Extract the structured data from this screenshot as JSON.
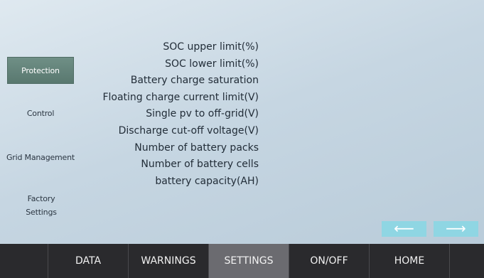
{
  "sidebar": {
    "items": [
      {
        "label": "Protection",
        "active": true
      },
      {
        "label": "Control",
        "active": false
      },
      {
        "label": "Grid Management",
        "active": false
      },
      {
        "label": "Factory Settings",
        "active": false
      }
    ]
  },
  "parameters": [
    "SOC upper limit(%)",
    "SOC lower limit(%)",
    "Battery charge saturation",
    "Floating charge current limit(V)",
    "Single pv to off-grid(V)",
    "Discharge cut-off voltage(V)",
    "Number of battery packs",
    "Number of battery cells",
    "battery capacity(AH)"
  ],
  "pager": {
    "prev_icon": "arrow-left-icon",
    "next_icon": "arrow-right-icon",
    "prev_glyph": "⟵",
    "next_glyph": "⟶"
  },
  "nav": {
    "items": [
      {
        "label": "DATA",
        "active": false
      },
      {
        "label": "WARNINGS",
        "active": false
      },
      {
        "label": "SETTINGS",
        "active": true
      },
      {
        "label": "ON/OFF",
        "active": false
      },
      {
        "label": "HOME",
        "active": false
      }
    ]
  },
  "colors": {
    "active_tab": "#5f7e75",
    "arrow_button": "#8fd6e3",
    "bottom_bar": "#2a2a2d",
    "nav_active": "#6b6b70"
  }
}
